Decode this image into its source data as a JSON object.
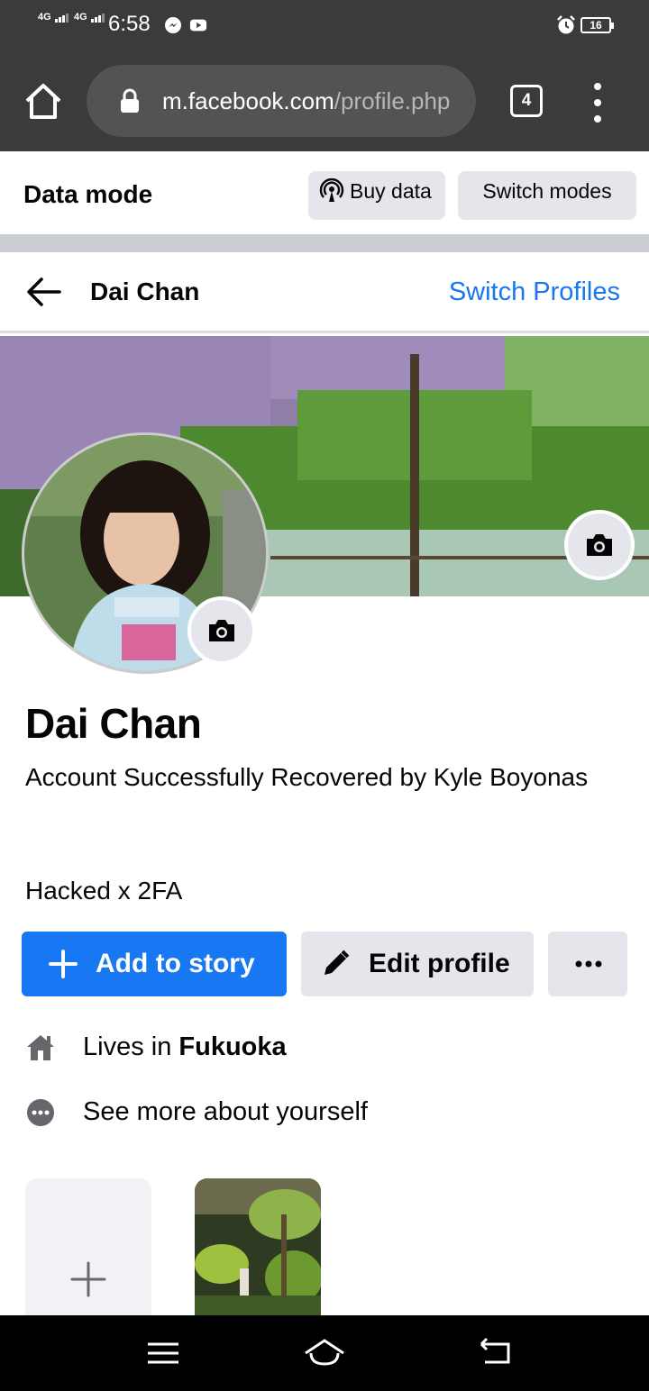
{
  "status_bar": {
    "network_1": "4G",
    "network_2": "4G",
    "time": "6:58",
    "battery": "16",
    "icons": [
      "messenger-icon",
      "youtube-icon",
      "alarm-icon",
      "battery-icon"
    ]
  },
  "browser": {
    "url_domain": "m.facebook.com",
    "url_path": "/profile.php",
    "tab_count": "4"
  },
  "data_mode": {
    "title": "Data mode",
    "buy_data": "Buy data",
    "switch_modes": "Switch modes"
  },
  "header": {
    "name": "Dai Chan",
    "switch_profiles": "Switch Profiles"
  },
  "profile": {
    "name": "Dai Chan",
    "bio_line": "Account Successfully Recovered by Kyle Boyonas",
    "bio_line_2": "Hacked x 2FA"
  },
  "actions": {
    "add_to_story": "Add to story",
    "edit_profile": "Edit profile"
  },
  "details": {
    "lives_prefix": "Lives in ",
    "lives_city": "Fukuoka",
    "see_more": "See more about yourself"
  },
  "colors": {
    "accent": "#1877f2",
    "toolbar": "#3a3b3d",
    "button_gray": "#e4e6eb"
  }
}
